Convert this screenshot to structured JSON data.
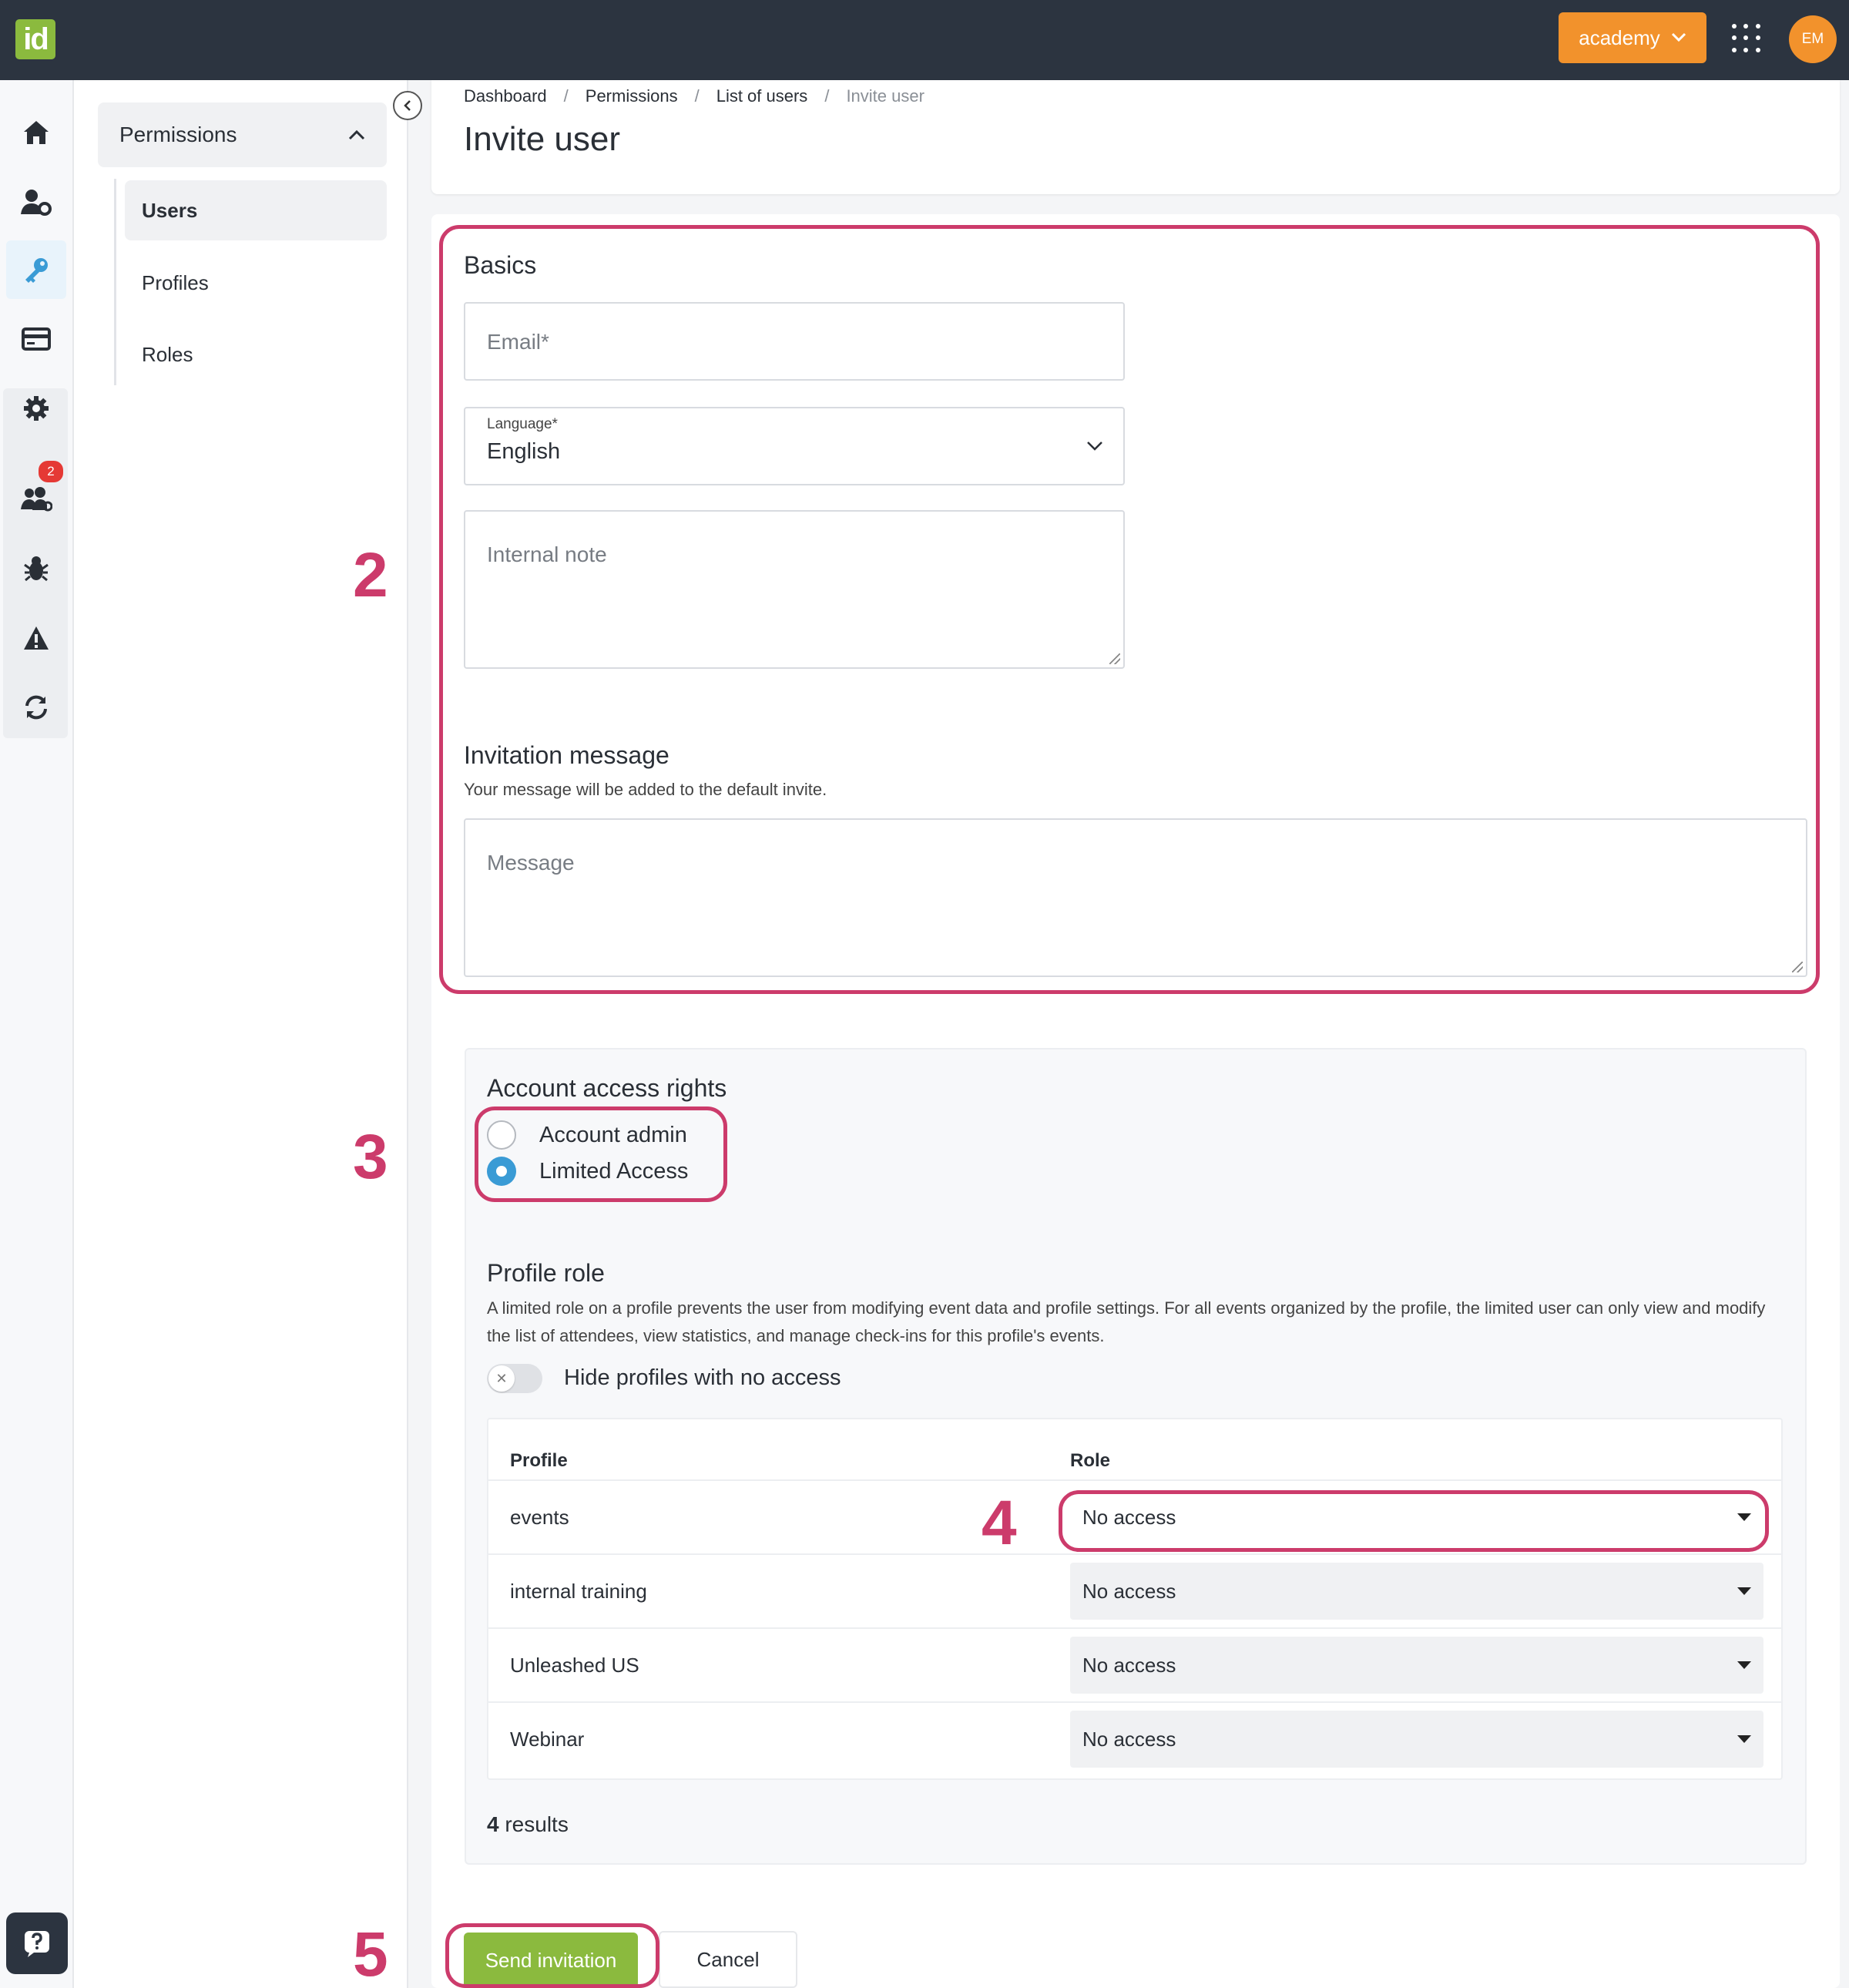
{
  "app": {
    "logo_text": "id"
  },
  "topbar": {
    "account_label": "academy",
    "avatar_initials": "EM"
  },
  "rail": {
    "icons": [
      "home-icon",
      "user-settings-icon",
      "key-icon",
      "credit-card-icon",
      "gear-icon",
      "users-icon",
      "bug-icon",
      "warning-icon",
      "refresh-icon",
      "help-chat-icon"
    ],
    "bug_badge": "2"
  },
  "sidebar": {
    "section_title": "Permissions",
    "items": [
      {
        "label": "Users",
        "active": true
      },
      {
        "label": "Profiles",
        "active": false
      },
      {
        "label": "Roles",
        "active": false
      }
    ]
  },
  "breadcrumb": {
    "items": [
      "Dashboard",
      "Permissions",
      "List of users",
      "Invite user"
    ]
  },
  "page_title": "Invite user",
  "basics": {
    "title": "Basics",
    "email_placeholder": "Email*",
    "language_label": "Language*",
    "language_value": "English",
    "note_placeholder": "Internal note"
  },
  "invitation": {
    "title": "Invitation message",
    "hint": "Your message will be added to the default invite.",
    "message_placeholder": "Message"
  },
  "access": {
    "title": "Account access rights",
    "options": [
      {
        "label": "Account admin",
        "checked": false
      },
      {
        "label": "Limited Access",
        "checked": true
      }
    ]
  },
  "profile_role": {
    "title": "Profile role",
    "description": "A limited role on a profile prevents the user from modifying event data and profile settings. For all events organized by the profile, the limited user can only view and modify the list of attendees, view statistics, and manage check-ins for this profile's events.",
    "toggle_label": "Hide profiles with no access",
    "toggle_on": false,
    "columns": [
      "Profile",
      "Role"
    ],
    "rows": [
      {
        "profile": "events",
        "role": "No access"
      },
      {
        "profile": "internal training",
        "role": "No access"
      },
      {
        "profile": "Unleashed US",
        "role": "No access"
      },
      {
        "profile": "Webinar",
        "role": "No access"
      }
    ],
    "results_count": "4",
    "results_label": "results"
  },
  "actions": {
    "send_label": "Send invitation",
    "cancel_label": "Cancel"
  },
  "annotations": [
    "2",
    "3",
    "4",
    "5"
  ],
  "colors": {
    "topbar": "#2c3440",
    "accent_orange": "#f2922c",
    "brand_green": "#8bba3e",
    "annotation": "#cc3b6b",
    "radio_blue": "#3a9bd5"
  }
}
